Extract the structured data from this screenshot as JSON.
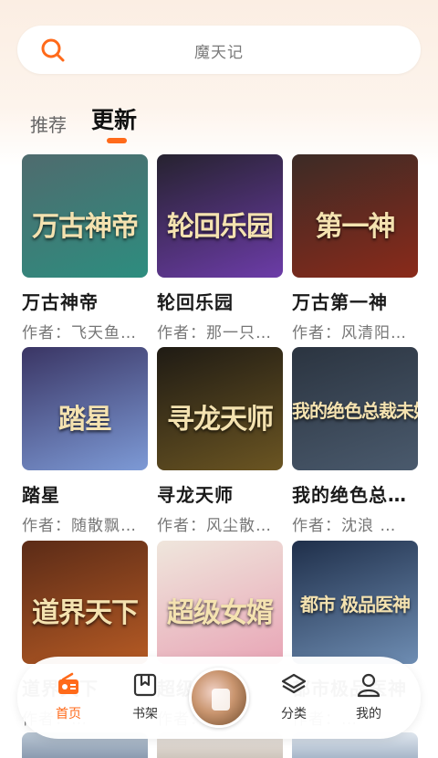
{
  "search": {
    "placeholder": "魔天记",
    "icon": "search-icon",
    "accent": "#ff6a1a"
  },
  "tabs": [
    {
      "label": "推荐",
      "active": false
    },
    {
      "label": "更新",
      "active": true
    }
  ],
  "books": [
    {
      "title": "万古神帝",
      "author": "作者：飞天鱼…",
      "cover_text": "万古神帝",
      "cover_colors": [
        "#4f6b6e",
        "#2d8d7f"
      ]
    },
    {
      "title": "轮回乐园",
      "author": "作者：那一只…",
      "cover_text": "轮回乐园",
      "cover_colors": [
        "#26222f",
        "#6c3ca8"
      ]
    },
    {
      "title": "万古第一神",
      "author": "作者：风清阳…",
      "cover_text": "第一神",
      "cover_colors": [
        "#3c2b26",
        "#8a2a1a"
      ]
    },
    {
      "title": "踏星",
      "author": "作者：随散飘…",
      "cover_text": "踏星",
      "cover_colors": [
        "#3a3564",
        "#7d9ad6"
      ]
    },
    {
      "title": "寻龙天师",
      "author": "作者：风尘散…",
      "cover_text": "寻龙天师",
      "cover_colors": [
        "#1f1b14",
        "#6b5522"
      ]
    },
    {
      "title": "我的绝色总…",
      "author": "作者：沈浪 …",
      "cover_text": "我的绝色总裁未婚妻",
      "cover_colors": [
        "#2b3440",
        "#4a5a6d"
      ]
    },
    {
      "title": "道界天下",
      "author": "作者：…",
      "cover_text": "道界天下",
      "cover_colors": [
        "#5b2b17",
        "#b55a24"
      ]
    },
    {
      "title": "超级女婿",
      "author": "作者：…",
      "cover_text": "超级女婿",
      "cover_colors": [
        "#efe6dc",
        "#e8a5b6"
      ]
    },
    {
      "title": "都市极品医神",
      "author": "作者：…",
      "cover_text": "都市 极品医神",
      "cover_colors": [
        "#1f2f4a",
        "#6e8db3"
      ]
    }
  ],
  "nav": [
    {
      "label": "首页",
      "icon": "radio-icon",
      "active": true
    },
    {
      "label": "书架",
      "icon": "bookmark-box-icon",
      "active": false
    },
    {
      "label": "分类",
      "icon": "layers-icon",
      "active": false
    },
    {
      "label": "我的",
      "icon": "user-icon",
      "active": false
    }
  ],
  "nav_center": {
    "icon": "now-playing-cover-icon"
  }
}
